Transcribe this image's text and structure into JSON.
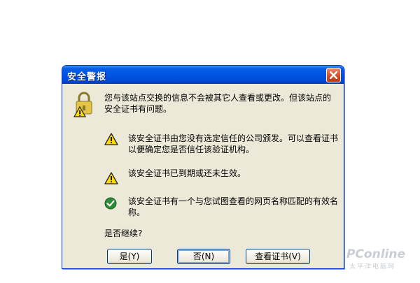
{
  "dialog": {
    "title": "安全警报",
    "message": "您与该站点交换的信息不会被其它人查看或更改。但该站点的安全证书有问题。",
    "items": [
      {
        "icon": "warning-icon",
        "text": "该安全证书由您没有选定信任的公司颁发。可以查看证书以便确定您是否信任该验证机构。"
      },
      {
        "icon": "warning-icon",
        "text": "该安全证书已到期或还未生效。"
      },
      {
        "icon": "check-icon",
        "text": "该安全证书有一个与您试图查看的网页名称匹配的有效名称。"
      }
    ],
    "question": "是否继续?",
    "buttons": {
      "yes": "是(Y)",
      "no": "否(N)",
      "view_cert": "查看证书(V)"
    }
  },
  "watermark": {
    "brand": "PConline",
    "subtitle": "太平洋电脑网"
  },
  "colors": {
    "titlebar": "#0054e3",
    "dialog_bg": "#ece9d8",
    "close": "#d24a22",
    "check": "#2f8a3a",
    "warning": "#ffd800"
  }
}
